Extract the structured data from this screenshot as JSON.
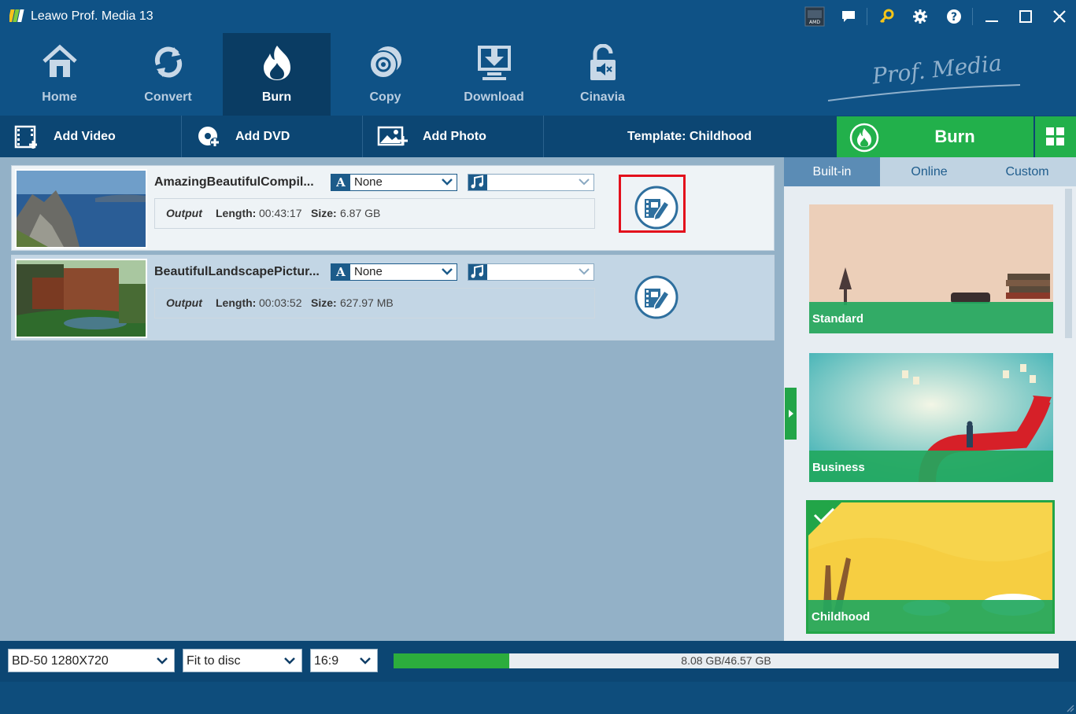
{
  "app": {
    "title": "Leawo Prof. Media 13"
  },
  "titlebar_icons": [
    "amd-badge-icon",
    "feedback-icon",
    "key-icon",
    "settings-icon",
    "help-icon",
    "minimize-icon",
    "maximize-icon",
    "close-icon"
  ],
  "nav": [
    {
      "label": "Home",
      "icon": "home-icon"
    },
    {
      "label": "Convert",
      "icon": "convert-icon"
    },
    {
      "label": "Burn",
      "icon": "burn-icon",
      "active": true
    },
    {
      "label": "Copy",
      "icon": "copy-disc-icon"
    },
    {
      "label": "Download",
      "icon": "download-icon"
    },
    {
      "label": "Cinavia",
      "icon": "cinavia-icon"
    }
  ],
  "brand": {
    "text": "Prof. Media"
  },
  "toolbar": {
    "add_video": "Add Video",
    "add_dvd": "Add DVD",
    "add_photo": "Add Photo",
    "template": "Template: Childhood",
    "burn": "Burn"
  },
  "files": [
    {
      "name": "AmazingBeautifulCompil...",
      "subtitle": "None",
      "output_label": "Output",
      "length_label": "Length:",
      "length": "00:43:17",
      "size_label": "Size:",
      "size": "6.87 GB"
    },
    {
      "name": "BeautifulLandscapePictur...",
      "subtitle": "None",
      "output_label": "Output",
      "length_label": "Length:",
      "length": "00:03:52",
      "size_label": "Size:",
      "size": "627.97 MB"
    }
  ],
  "sidebar": {
    "tabs": [
      "Built-in",
      "Online",
      "Custom"
    ],
    "active_tab": "Built-in",
    "templates": [
      {
        "name": "Standard",
        "selected": false
      },
      {
        "name": "Business",
        "selected": false
      },
      {
        "name": "Childhood",
        "selected": true
      }
    ]
  },
  "bottom": {
    "disc_type": "BD-50 1280X720",
    "fit": "Fit to disc",
    "aspect": "16:9",
    "usage_text": "8.08 GB/46.57 GB",
    "usage_fraction": 0.1735
  },
  "colors": {
    "brand_blue": "#0f5286",
    "burn_green": "#22b04b",
    "highlight_red": "#e3101c"
  }
}
